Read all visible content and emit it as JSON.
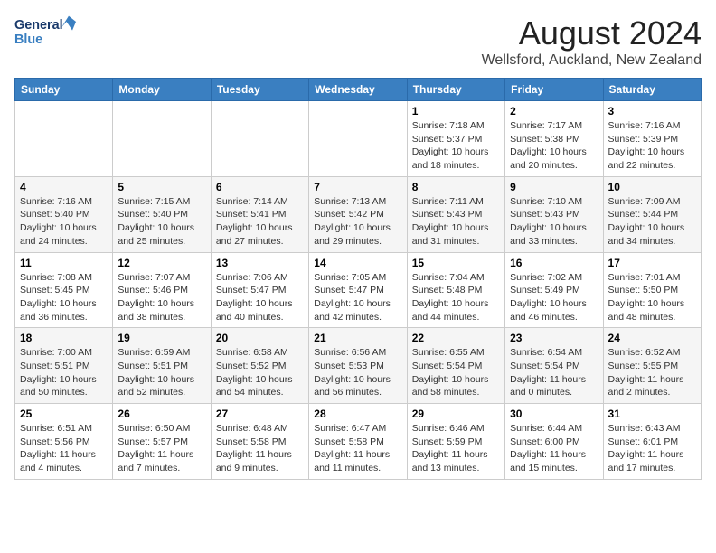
{
  "logo": {
    "line1": "General",
    "line2": "Blue"
  },
  "title": "August 2024",
  "subtitle": "Wellsford, Auckland, New Zealand",
  "weekdays": [
    "Sunday",
    "Monday",
    "Tuesday",
    "Wednesday",
    "Thursday",
    "Friday",
    "Saturday"
  ],
  "weeks": [
    [
      {
        "day": "",
        "info": ""
      },
      {
        "day": "",
        "info": ""
      },
      {
        "day": "",
        "info": ""
      },
      {
        "day": "",
        "info": ""
      },
      {
        "day": "1",
        "info": "Sunrise: 7:18 AM\nSunset: 5:37 PM\nDaylight: 10 hours\nand 18 minutes."
      },
      {
        "day": "2",
        "info": "Sunrise: 7:17 AM\nSunset: 5:38 PM\nDaylight: 10 hours\nand 20 minutes."
      },
      {
        "day": "3",
        "info": "Sunrise: 7:16 AM\nSunset: 5:39 PM\nDaylight: 10 hours\nand 22 minutes."
      }
    ],
    [
      {
        "day": "4",
        "info": "Sunrise: 7:16 AM\nSunset: 5:40 PM\nDaylight: 10 hours\nand 24 minutes."
      },
      {
        "day": "5",
        "info": "Sunrise: 7:15 AM\nSunset: 5:40 PM\nDaylight: 10 hours\nand 25 minutes."
      },
      {
        "day": "6",
        "info": "Sunrise: 7:14 AM\nSunset: 5:41 PM\nDaylight: 10 hours\nand 27 minutes."
      },
      {
        "day": "7",
        "info": "Sunrise: 7:13 AM\nSunset: 5:42 PM\nDaylight: 10 hours\nand 29 minutes."
      },
      {
        "day": "8",
        "info": "Sunrise: 7:11 AM\nSunset: 5:43 PM\nDaylight: 10 hours\nand 31 minutes."
      },
      {
        "day": "9",
        "info": "Sunrise: 7:10 AM\nSunset: 5:43 PM\nDaylight: 10 hours\nand 33 minutes."
      },
      {
        "day": "10",
        "info": "Sunrise: 7:09 AM\nSunset: 5:44 PM\nDaylight: 10 hours\nand 34 minutes."
      }
    ],
    [
      {
        "day": "11",
        "info": "Sunrise: 7:08 AM\nSunset: 5:45 PM\nDaylight: 10 hours\nand 36 minutes."
      },
      {
        "day": "12",
        "info": "Sunrise: 7:07 AM\nSunset: 5:46 PM\nDaylight: 10 hours\nand 38 minutes."
      },
      {
        "day": "13",
        "info": "Sunrise: 7:06 AM\nSunset: 5:47 PM\nDaylight: 10 hours\nand 40 minutes."
      },
      {
        "day": "14",
        "info": "Sunrise: 7:05 AM\nSunset: 5:47 PM\nDaylight: 10 hours\nand 42 minutes."
      },
      {
        "day": "15",
        "info": "Sunrise: 7:04 AM\nSunset: 5:48 PM\nDaylight: 10 hours\nand 44 minutes."
      },
      {
        "day": "16",
        "info": "Sunrise: 7:02 AM\nSunset: 5:49 PM\nDaylight: 10 hours\nand 46 minutes."
      },
      {
        "day": "17",
        "info": "Sunrise: 7:01 AM\nSunset: 5:50 PM\nDaylight: 10 hours\nand 48 minutes."
      }
    ],
    [
      {
        "day": "18",
        "info": "Sunrise: 7:00 AM\nSunset: 5:51 PM\nDaylight: 10 hours\nand 50 minutes."
      },
      {
        "day": "19",
        "info": "Sunrise: 6:59 AM\nSunset: 5:51 PM\nDaylight: 10 hours\nand 52 minutes."
      },
      {
        "day": "20",
        "info": "Sunrise: 6:58 AM\nSunset: 5:52 PM\nDaylight: 10 hours\nand 54 minutes."
      },
      {
        "day": "21",
        "info": "Sunrise: 6:56 AM\nSunset: 5:53 PM\nDaylight: 10 hours\nand 56 minutes."
      },
      {
        "day": "22",
        "info": "Sunrise: 6:55 AM\nSunset: 5:54 PM\nDaylight: 10 hours\nand 58 minutes."
      },
      {
        "day": "23",
        "info": "Sunrise: 6:54 AM\nSunset: 5:54 PM\nDaylight: 11 hours\nand 0 minutes."
      },
      {
        "day": "24",
        "info": "Sunrise: 6:52 AM\nSunset: 5:55 PM\nDaylight: 11 hours\nand 2 minutes."
      }
    ],
    [
      {
        "day": "25",
        "info": "Sunrise: 6:51 AM\nSunset: 5:56 PM\nDaylight: 11 hours\nand 4 minutes."
      },
      {
        "day": "26",
        "info": "Sunrise: 6:50 AM\nSunset: 5:57 PM\nDaylight: 11 hours\nand 7 minutes."
      },
      {
        "day": "27",
        "info": "Sunrise: 6:48 AM\nSunset: 5:58 PM\nDaylight: 11 hours\nand 9 minutes."
      },
      {
        "day": "28",
        "info": "Sunrise: 6:47 AM\nSunset: 5:58 PM\nDaylight: 11 hours\nand 11 minutes."
      },
      {
        "day": "29",
        "info": "Sunrise: 6:46 AM\nSunset: 5:59 PM\nDaylight: 11 hours\nand 13 minutes."
      },
      {
        "day": "30",
        "info": "Sunrise: 6:44 AM\nSunset: 6:00 PM\nDaylight: 11 hours\nand 15 minutes."
      },
      {
        "day": "31",
        "info": "Sunrise: 6:43 AM\nSunset: 6:01 PM\nDaylight: 11 hours\nand 17 minutes."
      }
    ]
  ]
}
